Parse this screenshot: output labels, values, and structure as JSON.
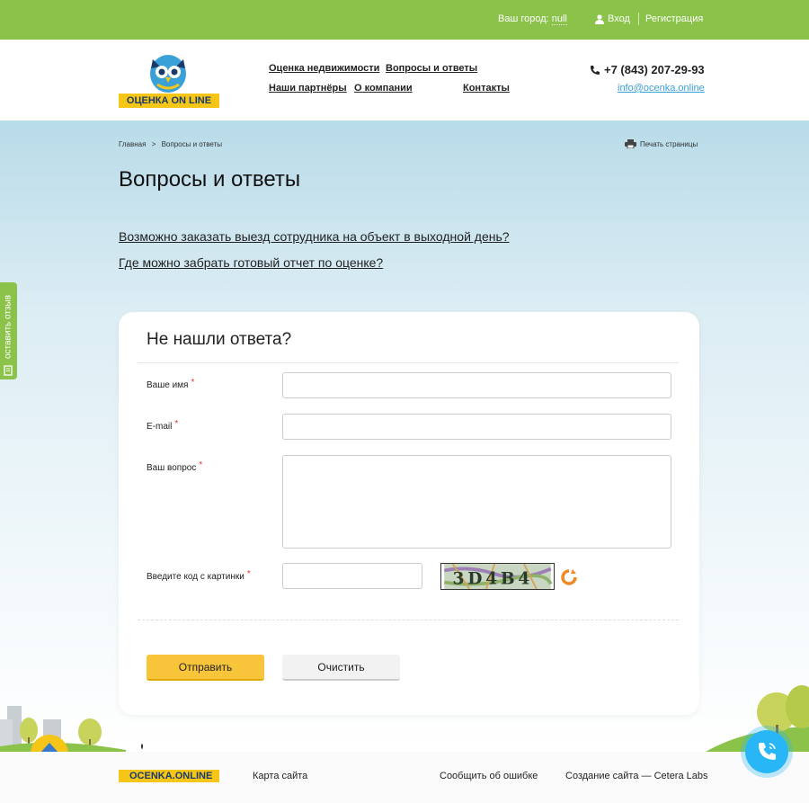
{
  "topbar": {
    "city_label": "Ваш город:",
    "city_value": "null",
    "login": "Вход",
    "register": "Регистрация"
  },
  "header": {
    "logo_text": "ОЦЕНКА ON LINE",
    "nav": [
      "Оценка недвижимости",
      "Вопросы и ответы",
      "Наши партнёры",
      "О компании",
      "Контакты"
    ],
    "phone": "+7 (843) 207-29-93",
    "email": "info@ocenka.online"
  },
  "breadcrumb": {
    "home": "Главная",
    "sep": ">",
    "current": "Вопросы и ответы"
  },
  "print_label": "Печать страницы",
  "page_title": "Вопросы и ответы",
  "questions": [
    "Возможно заказать выезд сотрудника на объект в выходной день?",
    "Где можно забрать готовый отчет по оценке?"
  ],
  "form": {
    "title": "Не нашли ответа?",
    "name_label": "Ваше имя",
    "email_label": "E-mail",
    "question_label": "Ваш вопрос",
    "captcha_label": "Введите код с картинки",
    "required_mark": "*",
    "captcha_text": "3D4B4",
    "submit": "Отправить",
    "clear": "Очистить"
  },
  "side_tab": "оставить отзыв",
  "footer": {
    "logo": "OCENKA.ONLINE",
    "sitemap": "Карта сайта",
    "report_error": "Сообщить об ошибке",
    "credits": "Создание сайта — Cetera Labs"
  },
  "colors": {
    "brand_green": "#8bc34a",
    "brand_yellow": "#f5c518",
    "call_blue": "#29b6f6"
  }
}
